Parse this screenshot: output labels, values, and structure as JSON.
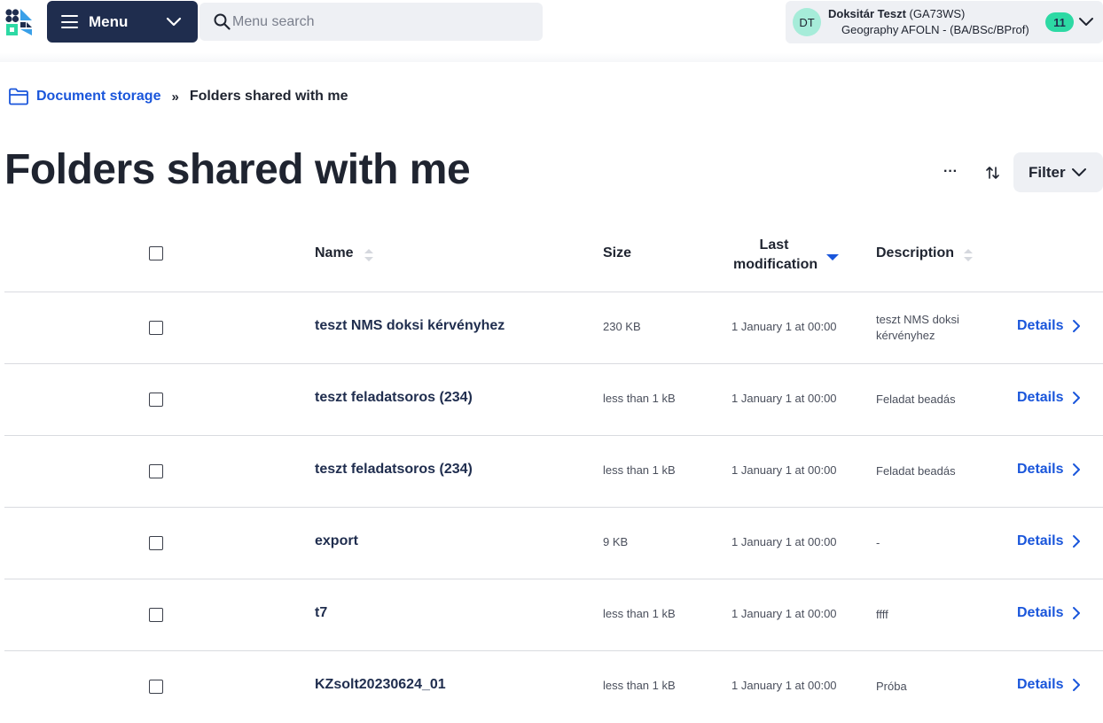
{
  "header": {
    "menu_label": "Menu",
    "search_placeholder": "Menu search",
    "user": {
      "initials": "DT",
      "name": "Doksitár Teszt",
      "code": "(GA73WS)",
      "program": "Geography AFOLN - (BA/BSc/BProf)",
      "notification_count": "11"
    }
  },
  "breadcrumb": {
    "parent": "Document storage",
    "separator": "»",
    "current": "Folders shared with me"
  },
  "page": {
    "title": "Folders shared with me",
    "more_label": "···",
    "filter_label": "Filter"
  },
  "table": {
    "columns": {
      "name": "Name",
      "size": "Size",
      "last_modification_line1": "Last",
      "last_modification_line2": "modification",
      "description": "Description"
    },
    "details_label": "Details",
    "rows": [
      {
        "name": "teszt NMS doksi kérvényhez",
        "size": "230 KB",
        "modified": "1 January 1 at 00:00",
        "description": "teszt NMS doksi kérvényhez"
      },
      {
        "name": "teszt feladatsoros (234)",
        "size": "less than 1 kB",
        "modified": "1 January 1 at 00:00",
        "description": "Feladat beadás"
      },
      {
        "name": "teszt feladatsoros (234)",
        "size": "less than 1 kB",
        "modified": "1 January 1 at 00:00",
        "description": "Feladat beadás"
      },
      {
        "name": "export",
        "size": "9 KB",
        "modified": "1 January 1 at 00:00",
        "description": "-"
      },
      {
        "name": "t7",
        "size": "less than 1 kB",
        "modified": "1 January 1 at 00:00",
        "description": "ffff"
      },
      {
        "name": "KZsolt20230624_01",
        "size": "less than 1 kB",
        "modified": "1 January 1 at 00:00",
        "description": "Próba"
      }
    ]
  },
  "colors": {
    "menu_bg": "#1f2d4e",
    "accent_blue": "#1a56db",
    "badge_green": "#2dd9a4",
    "avatar_bg": "#a6ecd9"
  }
}
